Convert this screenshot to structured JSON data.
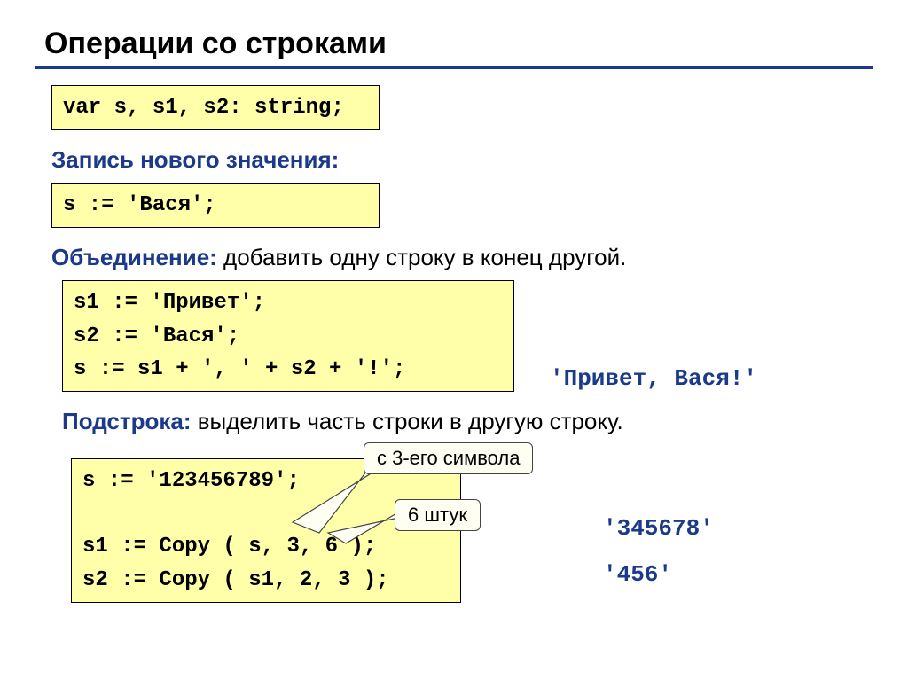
{
  "title": "Операции со строками",
  "declBox": "var s, s1, s2: string;",
  "sections": {
    "assign": {
      "head": "Запись нового значения:",
      "tail": "",
      "code": "s := 'Вася';"
    },
    "concat": {
      "head": "Объединение:",
      "tail": " добавить одну строку в конец другой.",
      "lines": [
        "s1 := 'Привет';",
        "s2 := 'Вася';",
        "s := s1 + ', ' + s2 + '!';"
      ],
      "result": "'Привет, Вася!'"
    },
    "substr": {
      "head": "Подстрока:",
      "tail": " выделить часть строки в другую строку.",
      "lines": [
        "s := '123456789';",
        "",
        "s1 := Copy ( s, 3, 6 );",
        "s2 := Copy ( s1, 2, 3 );"
      ],
      "callout1": "с 3-его символа",
      "callout2": "6 штук",
      "result1": "'345678'",
      "result2": "'456'"
    }
  }
}
